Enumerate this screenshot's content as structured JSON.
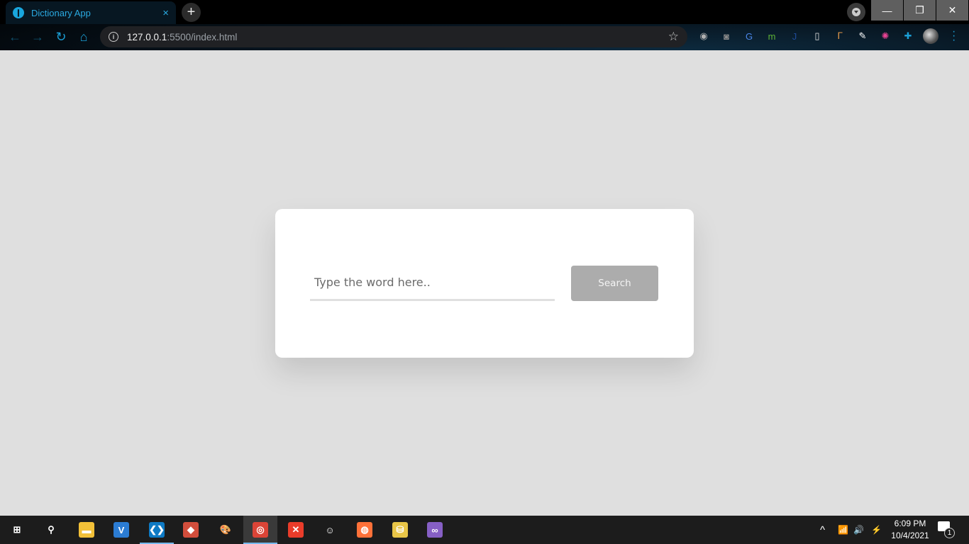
{
  "browser": {
    "tab": {
      "title": "Dictionary App",
      "favicon": "dictionary-book-icon",
      "close": "×"
    },
    "new_tab": "+",
    "window_controls": {
      "minimize": "—",
      "restore": "❐",
      "close": "✕"
    },
    "nav": {
      "back": "←",
      "forward": "→",
      "reload": "↻",
      "home": "⌂"
    },
    "address": {
      "host": "127.0.0.1",
      "rest": ":5500/index.html",
      "info_icon": "i",
      "star": "☆"
    },
    "extensions": [
      {
        "name": "screenshot-camera-icon",
        "glyph": "◉",
        "color": "#b0b0b0"
      },
      {
        "name": "camera-icon",
        "glyph": "◙",
        "color": "#8a8a8a"
      },
      {
        "name": "google-translate-icon",
        "glyph": "G",
        "color": "#4a86e8"
      },
      {
        "name": "monster-icon",
        "glyph": "m",
        "color": "#5fb336"
      },
      {
        "name": "j-extension-icon",
        "glyph": "J",
        "color": "#1f4c9b"
      },
      {
        "name": "device-frame-icon",
        "glyph": "▯",
        "color": "#e0e0e0"
      },
      {
        "name": "t-extension-icon",
        "glyph": "ᒥ",
        "color": "#e59a4a"
      },
      {
        "name": "color-picker-icon",
        "glyph": "✎",
        "color": "#ffffff"
      },
      {
        "name": "color-wheel-icon",
        "glyph": "✺",
        "color": "#e84393"
      },
      {
        "name": "extensions-puzzle-icon",
        "glyph": "✚",
        "color": "#1b9fd6"
      }
    ],
    "menu": "⋮"
  },
  "page": {
    "search": {
      "placeholder": "Type the word here..",
      "value": "",
      "button_label": "Search"
    }
  },
  "taskbar": {
    "items": [
      {
        "name": "start-windows-icon",
        "glyph": "⊞",
        "bg": "transparent",
        "active": false,
        "open": false
      },
      {
        "name": "search-icon",
        "glyph": "⚲",
        "bg": "transparent",
        "active": false,
        "open": false
      },
      {
        "name": "file-explorer-icon",
        "glyph": "▬",
        "bg": "#f2c038",
        "active": false,
        "open": false
      },
      {
        "name": "office-icon",
        "glyph": "V",
        "bg": "#2b7cd3",
        "active": false,
        "open": false
      },
      {
        "name": "vscode-icon",
        "glyph": "❮❯",
        "bg": "#0e7ac4",
        "active": false,
        "open": true
      },
      {
        "name": "git-icon",
        "glyph": "◆",
        "bg": "#d24e3c",
        "active": false,
        "open": false
      },
      {
        "name": "paint-icon",
        "glyph": "🎨",
        "bg": "transparent",
        "active": false,
        "open": false
      },
      {
        "name": "chrome-icon",
        "glyph": "◎",
        "bg": "#db4437",
        "active": true,
        "open": true
      },
      {
        "name": "xampp-icon",
        "glyph": "✕",
        "bg": "#ea3c2a",
        "active": false,
        "open": false
      },
      {
        "name": "smiley-app-icon",
        "glyph": "☺",
        "bg": "transparent",
        "active": false,
        "open": false
      },
      {
        "name": "firefox-icon",
        "glyph": "◍",
        "bg": "#ff7139",
        "active": false,
        "open": false
      },
      {
        "name": "database-tool-icon",
        "glyph": "⛁",
        "bg": "#e8c547",
        "active": false,
        "open": false
      },
      {
        "name": "visual-studio-icon",
        "glyph": "∞",
        "bg": "#865fc5",
        "active": false,
        "open": false
      }
    ],
    "tray": {
      "chevron": "^",
      "wifi": "📶",
      "volume": "🔊",
      "battery": "⚡",
      "time": "6:09 PM",
      "date": "10/4/2021",
      "notification_count": "1"
    }
  }
}
